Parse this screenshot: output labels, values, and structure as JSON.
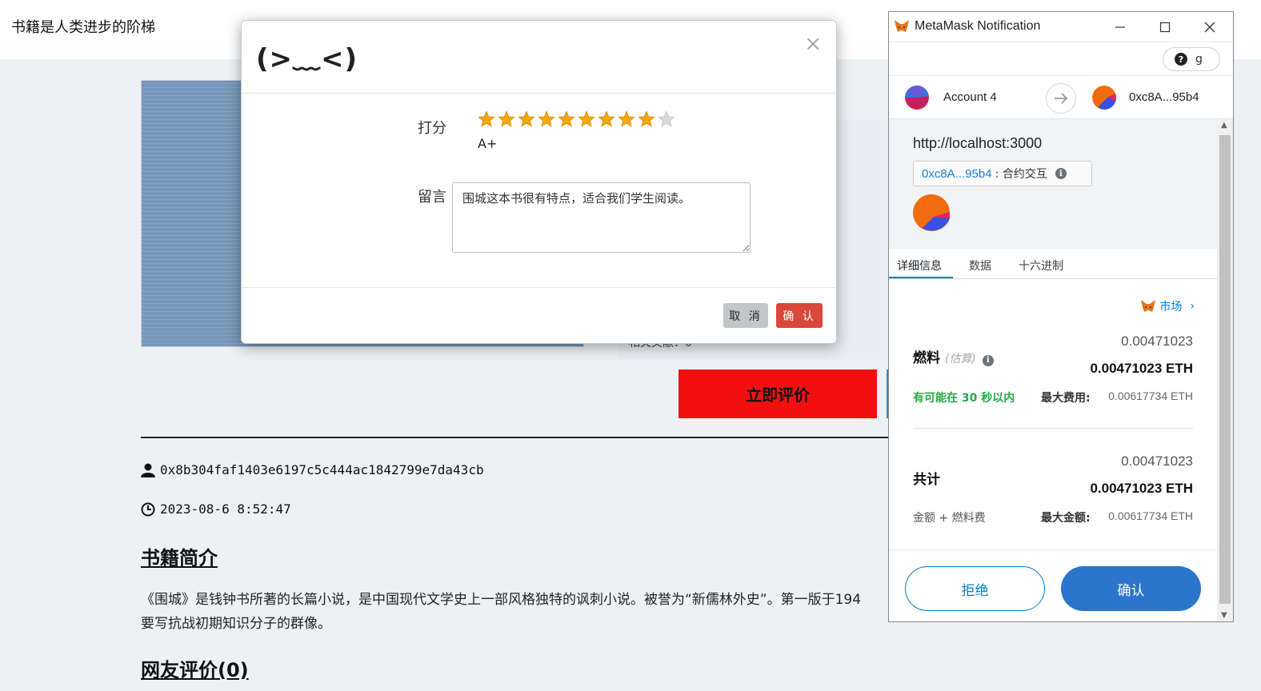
{
  "page": {
    "site_title": "书籍是人类进步的阶梯",
    "hidden_meta": "相关文献：0",
    "review_button": "立即评价",
    "author_address": "0x8b304faf1403e6197c5c444ac1842799e7da43cb",
    "timestamp": "2023-08-6 8:52:47",
    "intro_heading": "书籍简介",
    "intro_line1": "《围城》是钱钟书所著的长篇小说，是中国现代文学史上一部风格独特的讽刺小说。被誉为“新儒林外史”。第一版于194",
    "intro_line2": "要写抗战初期知识分子的群像。",
    "reviews_heading": "网友评价(0)"
  },
  "modal": {
    "emoticon": "(>﹏<)",
    "close": "×",
    "score_label": "打分",
    "rating": 9,
    "rating_max": 10,
    "grade": "A+",
    "comment_label": "留言",
    "comment_value": "围城这本书很有特点，适合我们学生阅读。",
    "cancel": "取 消",
    "confirm": "确 认"
  },
  "metamask": {
    "window_title": "MetaMask Notification",
    "help_text": "g",
    "from_account": "Account 4",
    "to_address": "0xc8A...95b4",
    "origin": "http://localhost:3000",
    "contract_address": "0xc8A...95b4",
    "contract_label": ": 合约交互",
    "tabs": [
      "详细信息",
      "数据",
      "十六进制"
    ],
    "market_label": "市场",
    "gas_label": "燃料",
    "gas_estimate_tag": "(估算)",
    "gas_amount": "0.00471023",
    "gas_amount_eth": "0.00471023 ETH",
    "gas_eta": "有可能在 30 秒以内",
    "max_fee_label": "最大费用:",
    "max_fee_value": "0.00617734 ETH",
    "total_label": "共计",
    "total_amount": "0.00471023",
    "total_amount_eth": "0.00471023 ETH",
    "total_sub_label": "金额 + 燃料费",
    "max_amount_label": "最大金额:",
    "max_amount_value": "0.00617734 ETH",
    "reject": "拒绝",
    "confirm": "确认",
    "colors": {
      "accent": "#037dd6",
      "confirm_bg": "#2b76cc",
      "gas_eta": "#28a745"
    }
  }
}
